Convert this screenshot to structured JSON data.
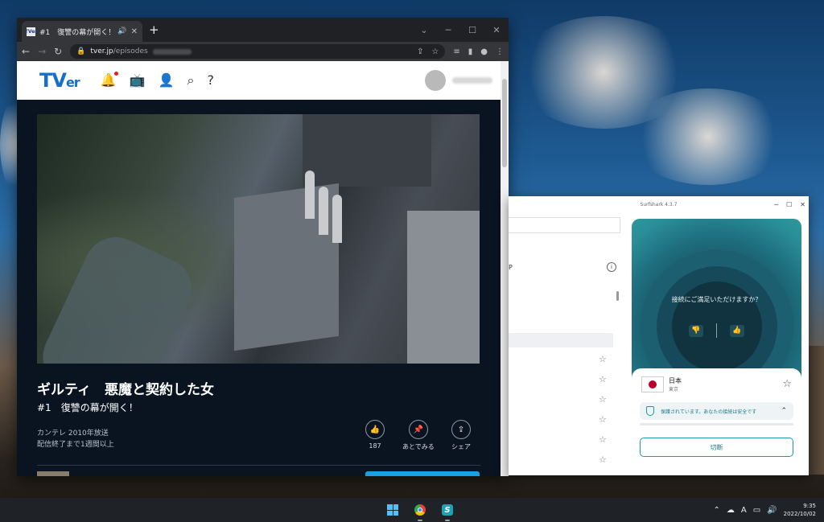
{
  "browser": {
    "tab_title": "#1　復讐の幕が開く！ | TVer",
    "favicon_text": "TVer",
    "url_domain": "tver.jp",
    "url_path": "/episodes"
  },
  "tver": {
    "logo_main": "TV",
    "logo_sub": "er",
    "icons": [
      "bell-icon",
      "tv-icon",
      "person-icon",
      "search-icon",
      "help-icon"
    ]
  },
  "program": {
    "title": "ギルティ　悪魔と契約した女",
    "episode": "#1　復讐の幕が開く！",
    "broadcaster": "カンテレ 2010年放送",
    "availability": "配信終了まで1週間以上",
    "actions": [
      {
        "icon": "thumbs-up-icon",
        "label": "187"
      },
      {
        "icon": "pin-icon",
        "label": "あとでみる"
      },
      {
        "icon": "share-icon",
        "label": "シェア"
      }
    ]
  },
  "surfshark": {
    "window_title": "Surfshark 4.3.7",
    "left_label_p": "P",
    "question": "接続にご満足いただけますか？",
    "country": "日本",
    "city": "東京",
    "status_text": "保護されています。あなたの接続は安全です",
    "disconnect_label": "切断"
  },
  "taskbar": {
    "time": "9:35",
    "date": "2022/10/02",
    "ime": "A"
  },
  "colors": {
    "tver_blue": "#1670c9",
    "surfshark_teal": "#1b9aa8",
    "chrome_dark": "#202124"
  }
}
